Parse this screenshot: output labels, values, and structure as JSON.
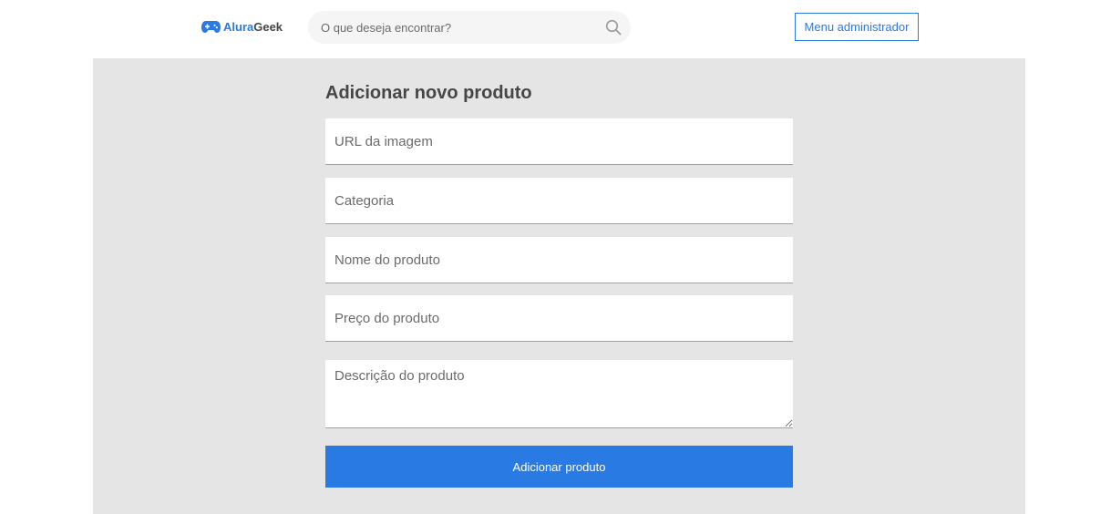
{
  "header": {
    "logo": {
      "icon": "gamepad-icon",
      "brand_first": "Alura",
      "brand_second": "Geek"
    },
    "search": {
      "placeholder": "O que deseja encontrar?",
      "value": "",
      "icon": "search-icon"
    },
    "admin_button_label": "Menu administrador"
  },
  "form": {
    "title": "Adicionar novo produto",
    "fields": {
      "image_url": {
        "placeholder": "URL da imagem",
        "value": ""
      },
      "category": {
        "placeholder": "Categoria",
        "value": ""
      },
      "name": {
        "placeholder": "Nome do produto",
        "value": ""
      },
      "price": {
        "placeholder": "Preço do produto",
        "value": ""
      },
      "description": {
        "placeholder": "Descrição do produto",
        "value": ""
      }
    },
    "submit_label": "Adicionar produto"
  },
  "colors": {
    "accent": "#2a7ae4",
    "panel_background": "#e5e5e5",
    "text_dark": "#464646"
  }
}
